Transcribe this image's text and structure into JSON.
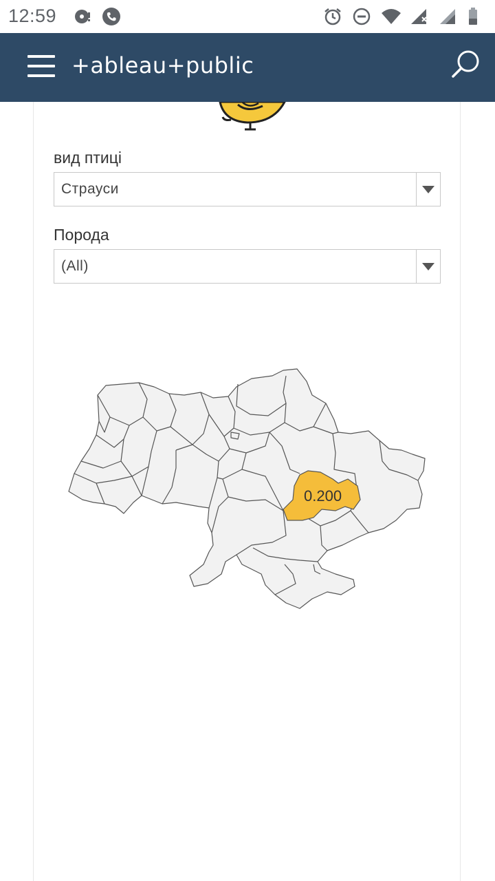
{
  "status_bar": {
    "time": "12:59",
    "left_icons": [
      "cast-icon",
      "phone-icon"
    ],
    "right_icons": [
      "alarm-icon",
      "do-not-disturb-icon",
      "wifi-icon",
      "cellular-signal-icon",
      "cellular-signal-2-icon",
      "battery-icon"
    ]
  },
  "app_bar": {
    "logo_text": "+ableau+public",
    "menu_icon": "hamburger-menu-icon",
    "search_icon": "search-icon",
    "background_color": "#2e4a66"
  },
  "filters": {
    "bird_type": {
      "label": "вид птиці",
      "value": "Страуси"
    },
    "breed": {
      "label": "Порода",
      "value": "(All)"
    }
  },
  "map": {
    "highlighted_region_value": "0.200",
    "highlight_color": "#f5bd3a",
    "region_fill": "#f2f2f2",
    "region_stroke": "#555555"
  }
}
